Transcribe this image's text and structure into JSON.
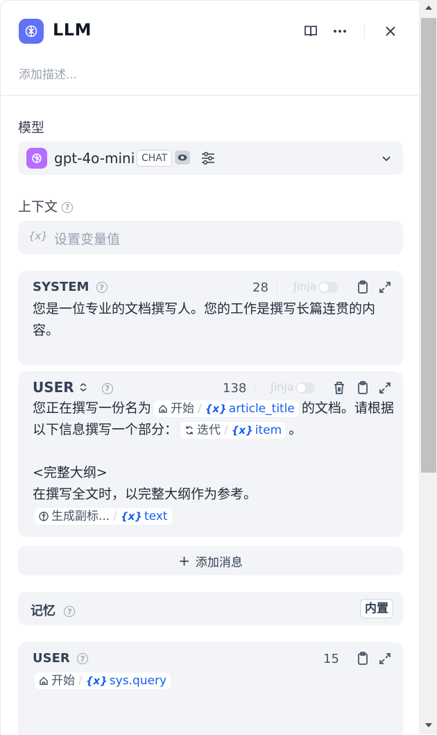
{
  "header": {
    "title": "LLM",
    "description_placeholder": "添加描述..."
  },
  "model": {
    "section_label": "模型",
    "name": "gpt-4o-mini",
    "mode_badge": "CHAT"
  },
  "context": {
    "section_label": "上下文",
    "placeholder": "设置变量值",
    "var_symbol": "{x}"
  },
  "system_prompt": {
    "role": "SYSTEM",
    "count": "28",
    "jinja_label": "Jinja",
    "text": "您是一位专业的文档撰写人。您的工作是撰写长篇连贯的内容。"
  },
  "user_prompt": {
    "role": "USER",
    "count": "138",
    "jinja_label": "Jinja",
    "line1_a": "您正在撰写一份名为",
    "chip1_node": "开始",
    "chip1_var": "article_title",
    "line1_b": "的文档。请根据以下信息撰写一个部分：",
    "chip2_node": "迭代",
    "chip2_var": "item",
    "line1_c": "。",
    "line3": "<完整大纲>",
    "line4": "在撰写全文时，以完整大纲作为参考。",
    "chip3_node": "生成副标...",
    "chip3_var": "text"
  },
  "add_message": {
    "label": "添加消息"
  },
  "memory": {
    "label": "记忆",
    "badge": "内置"
  },
  "memory_user": {
    "role": "USER",
    "count": "15",
    "chip_node": "开始",
    "chip_var": "sys.query"
  },
  "colors": {
    "accent": "#6172f3",
    "model_logo": "#b66dff",
    "variable": "#155eef",
    "card_bg": "#f2f4f7"
  }
}
